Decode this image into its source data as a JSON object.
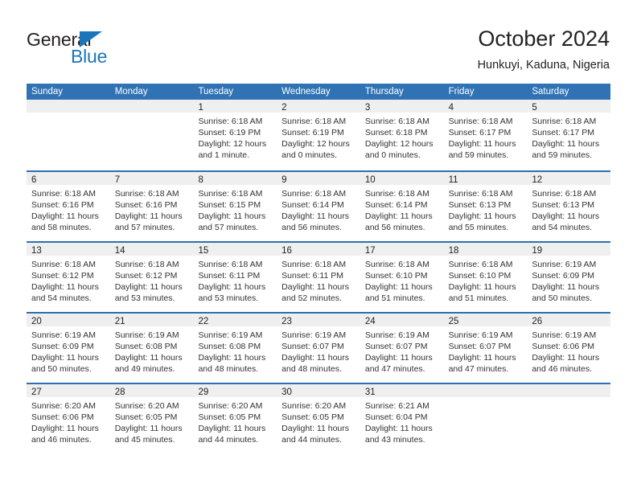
{
  "brand": {
    "name_part1": "General",
    "name_part2": "Blue",
    "triangle_icon": "triangle-icon",
    "accent_color": "#1b75bb"
  },
  "header": {
    "month_title": "October 2024",
    "location": "Hunkuyi, Kaduna, Nigeria"
  },
  "theme": {
    "header_blue": "#3073b5",
    "row_divider_blue": "#2e6fb0",
    "day_band_gray": "#efefef",
    "text_color": "#222222"
  },
  "calendar": {
    "weekdays": [
      "Sunday",
      "Monday",
      "Tuesday",
      "Wednesday",
      "Thursday",
      "Friday",
      "Saturday"
    ],
    "weeks": [
      [
        {
          "day": "",
          "empty": true
        },
        {
          "day": "",
          "empty": true
        },
        {
          "day": "1",
          "sunrise": "Sunrise: 6:18 AM",
          "sunset": "Sunset: 6:19 PM",
          "daylight": "Daylight: 12 hours and 1 minute."
        },
        {
          "day": "2",
          "sunrise": "Sunrise: 6:18 AM",
          "sunset": "Sunset: 6:19 PM",
          "daylight": "Daylight: 12 hours and 0 minutes."
        },
        {
          "day": "3",
          "sunrise": "Sunrise: 6:18 AM",
          "sunset": "Sunset: 6:18 PM",
          "daylight": "Daylight: 12 hours and 0 minutes."
        },
        {
          "day": "4",
          "sunrise": "Sunrise: 6:18 AM",
          "sunset": "Sunset: 6:17 PM",
          "daylight": "Daylight: 11 hours and 59 minutes."
        },
        {
          "day": "5",
          "sunrise": "Sunrise: 6:18 AM",
          "sunset": "Sunset: 6:17 PM",
          "daylight": "Daylight: 11 hours and 59 minutes."
        }
      ],
      [
        {
          "day": "6",
          "sunrise": "Sunrise: 6:18 AM",
          "sunset": "Sunset: 6:16 PM",
          "daylight": "Daylight: 11 hours and 58 minutes."
        },
        {
          "day": "7",
          "sunrise": "Sunrise: 6:18 AM",
          "sunset": "Sunset: 6:16 PM",
          "daylight": "Daylight: 11 hours and 57 minutes."
        },
        {
          "day": "8",
          "sunrise": "Sunrise: 6:18 AM",
          "sunset": "Sunset: 6:15 PM",
          "daylight": "Daylight: 11 hours and 57 minutes."
        },
        {
          "day": "9",
          "sunrise": "Sunrise: 6:18 AM",
          "sunset": "Sunset: 6:14 PM",
          "daylight": "Daylight: 11 hours and 56 minutes."
        },
        {
          "day": "10",
          "sunrise": "Sunrise: 6:18 AM",
          "sunset": "Sunset: 6:14 PM",
          "daylight": "Daylight: 11 hours and 56 minutes."
        },
        {
          "day": "11",
          "sunrise": "Sunrise: 6:18 AM",
          "sunset": "Sunset: 6:13 PM",
          "daylight": "Daylight: 11 hours and 55 minutes."
        },
        {
          "day": "12",
          "sunrise": "Sunrise: 6:18 AM",
          "sunset": "Sunset: 6:13 PM",
          "daylight": "Daylight: 11 hours and 54 minutes."
        }
      ],
      [
        {
          "day": "13",
          "sunrise": "Sunrise: 6:18 AM",
          "sunset": "Sunset: 6:12 PM",
          "daylight": "Daylight: 11 hours and 54 minutes."
        },
        {
          "day": "14",
          "sunrise": "Sunrise: 6:18 AM",
          "sunset": "Sunset: 6:12 PM",
          "daylight": "Daylight: 11 hours and 53 minutes."
        },
        {
          "day": "15",
          "sunrise": "Sunrise: 6:18 AM",
          "sunset": "Sunset: 6:11 PM",
          "daylight": "Daylight: 11 hours and 53 minutes."
        },
        {
          "day": "16",
          "sunrise": "Sunrise: 6:18 AM",
          "sunset": "Sunset: 6:11 PM",
          "daylight": "Daylight: 11 hours and 52 minutes."
        },
        {
          "day": "17",
          "sunrise": "Sunrise: 6:18 AM",
          "sunset": "Sunset: 6:10 PM",
          "daylight": "Daylight: 11 hours and 51 minutes."
        },
        {
          "day": "18",
          "sunrise": "Sunrise: 6:18 AM",
          "sunset": "Sunset: 6:10 PM",
          "daylight": "Daylight: 11 hours and 51 minutes."
        },
        {
          "day": "19",
          "sunrise": "Sunrise: 6:19 AM",
          "sunset": "Sunset: 6:09 PM",
          "daylight": "Daylight: 11 hours and 50 minutes."
        }
      ],
      [
        {
          "day": "20",
          "sunrise": "Sunrise: 6:19 AM",
          "sunset": "Sunset: 6:09 PM",
          "daylight": "Daylight: 11 hours and 50 minutes."
        },
        {
          "day": "21",
          "sunrise": "Sunrise: 6:19 AM",
          "sunset": "Sunset: 6:08 PM",
          "daylight": "Daylight: 11 hours and 49 minutes."
        },
        {
          "day": "22",
          "sunrise": "Sunrise: 6:19 AM",
          "sunset": "Sunset: 6:08 PM",
          "daylight": "Daylight: 11 hours and 48 minutes."
        },
        {
          "day": "23",
          "sunrise": "Sunrise: 6:19 AM",
          "sunset": "Sunset: 6:07 PM",
          "daylight": "Daylight: 11 hours and 48 minutes."
        },
        {
          "day": "24",
          "sunrise": "Sunrise: 6:19 AM",
          "sunset": "Sunset: 6:07 PM",
          "daylight": "Daylight: 11 hours and 47 minutes."
        },
        {
          "day": "25",
          "sunrise": "Sunrise: 6:19 AM",
          "sunset": "Sunset: 6:07 PM",
          "daylight": "Daylight: 11 hours and 47 minutes."
        },
        {
          "day": "26",
          "sunrise": "Sunrise: 6:19 AM",
          "sunset": "Sunset: 6:06 PM",
          "daylight": "Daylight: 11 hours and 46 minutes."
        }
      ],
      [
        {
          "day": "27",
          "sunrise": "Sunrise: 6:20 AM",
          "sunset": "Sunset: 6:06 PM",
          "daylight": "Daylight: 11 hours and 46 minutes."
        },
        {
          "day": "28",
          "sunrise": "Sunrise: 6:20 AM",
          "sunset": "Sunset: 6:05 PM",
          "daylight": "Daylight: 11 hours and 45 minutes."
        },
        {
          "day": "29",
          "sunrise": "Sunrise: 6:20 AM",
          "sunset": "Sunset: 6:05 PM",
          "daylight": "Daylight: 11 hours and 44 minutes."
        },
        {
          "day": "30",
          "sunrise": "Sunrise: 6:20 AM",
          "sunset": "Sunset: 6:05 PM",
          "daylight": "Daylight: 11 hours and 44 minutes."
        },
        {
          "day": "31",
          "sunrise": "Sunrise: 6:21 AM",
          "sunset": "Sunset: 6:04 PM",
          "daylight": "Daylight: 11 hours and 43 minutes."
        },
        {
          "day": "",
          "empty": true
        },
        {
          "day": "",
          "empty": true
        }
      ]
    ]
  }
}
